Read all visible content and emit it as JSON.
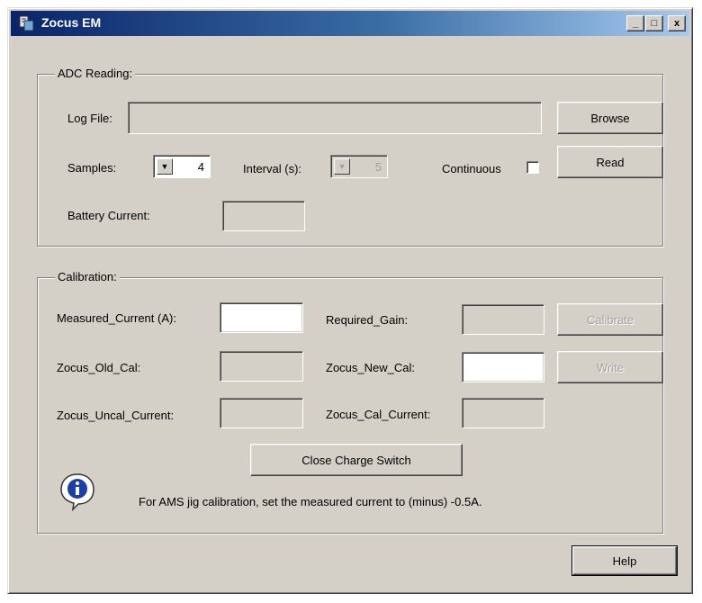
{
  "window": {
    "title": "Zocus EM",
    "minimize": "_",
    "maximize": "□",
    "close": "x"
  },
  "adc": {
    "group_title": "ADC Reading:",
    "log_file_label": "Log File:",
    "log_file_value": "",
    "browse_label": "Browse",
    "samples_label": "Samples:",
    "samples_value": "4",
    "interval_label": "Interval (s):",
    "interval_value": "5",
    "continuous_label": "Continuous",
    "continuous_checked": false,
    "read_label": "Read",
    "battery_current_label": "Battery Current:",
    "battery_current_value": ""
  },
  "calibration": {
    "group_title": "Calibration:",
    "measured_current_label": "Measured_Current (A):",
    "measured_current_value": "",
    "required_gain_label": "Required_Gain:",
    "required_gain_value": "",
    "calibrate_label": "Calibrate",
    "old_cal_label": "Zocus_Old_Cal:",
    "old_cal_value": "",
    "new_cal_label": "Zocus_New_Cal:",
    "new_cal_value": "",
    "write_label": "Write",
    "uncal_current_label": "Zocus_Uncal_Current:",
    "uncal_current_value": "",
    "cal_current_label": "Zocus_Cal_Current:",
    "cal_current_value": "",
    "close_charge_switch_label": "Close Charge Switch",
    "info_text": "For AMS jig calibration, set the measured current to (minus) -0.5A."
  },
  "help_label": "Help",
  "icons": {
    "app": "app-icon",
    "info": "info-icon",
    "spin": "chevron-down-icon"
  },
  "colors": {
    "face": "#d4d0c8",
    "title_start": "#0a246a",
    "title_end": "#a6caf0",
    "info_blue": "#1a3fa6"
  }
}
